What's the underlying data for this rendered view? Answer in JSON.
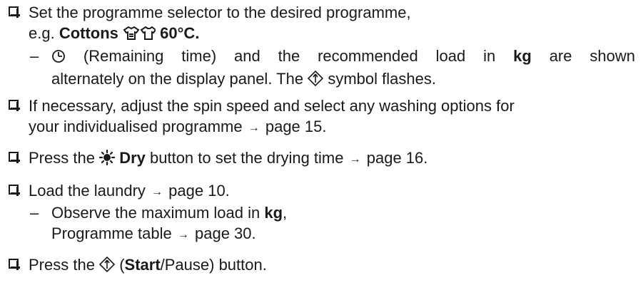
{
  "steps": {
    "s1": {
      "line1": "Set the programme selector to the desired programme,",
      "line2_prefix": "e.g. ",
      "line2_bold_prog": "Cottons",
      "line2_bold_temp": "60°C.",
      "sub": {
        "dash": "–",
        "part1": "(Remaining time) and the recommended load in",
        "bold_kg": "kg",
        "part2": "are shown",
        "line2_part1": "alternately on the display panel. The",
        "line2_part2": "symbol flashes."
      }
    },
    "s2": {
      "line1": "If necessary, adjust the spin speed and select any washing options for",
      "line2": "your individualised programme",
      "line2_ref": "page 15."
    },
    "s3": {
      "prefix": "Press the",
      "bold_dry": "Dry",
      "suffix": "button to set the drying time",
      "ref": "page 16."
    },
    "s4": {
      "line1": "Load the laundry",
      "line1_ref": "page 10.",
      "sub": {
        "dash": "–",
        "line1_part1": "Observe the maximum load in",
        "bold_kg": "kg",
        "line1_part2": ",",
        "line2": "Programme table",
        "line2_ref": "page 30."
      }
    },
    "s5": {
      "prefix": "Press the",
      "paren_open": "(",
      "bold_start": "Start",
      "suffix": "/Pause) button."
    }
  },
  "arrow_glyph": "→",
  "icons": [
    "checkbox-icon",
    "cottons-shirt-icon",
    "clock-icon",
    "start-pause-icon",
    "sun-icon",
    "arrow-icon"
  ]
}
